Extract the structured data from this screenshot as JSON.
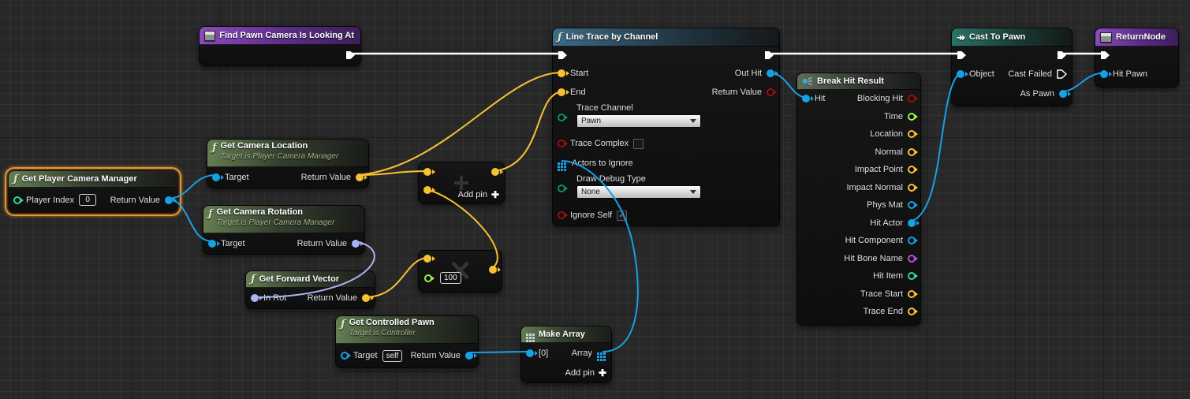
{
  "colors": {
    "background": "#282828",
    "exec_wire": "#ffffff",
    "vector": "#f7c231",
    "object": "#18a0e4",
    "rotator": "#a8b4f5",
    "float": "#9cf14b",
    "bool": "#9a0f0f",
    "enum": "#0e8a72",
    "int": "#2fd8a0",
    "name": "#bb4fd6",
    "selection": "#e8962e"
  },
  "nodes": {
    "find_pawn_camera": {
      "title": "Find Pawn Camera Is Looking At"
    },
    "get_player_camera_manager": {
      "title": "Get Player Camera Manager",
      "player_index_label": "Player Index",
      "player_index_value": "0",
      "return_value_label": "Return Value"
    },
    "get_camera_location": {
      "title": "Get Camera Location",
      "subtitle": "Target is Player Camera Manager",
      "target_label": "Target",
      "return_value_label": "Return Value"
    },
    "get_camera_rotation": {
      "title": "Get Camera Rotation",
      "subtitle": "Target is Player Camera Manager",
      "target_label": "Target",
      "return_value_label": "Return Value"
    },
    "get_forward_vector": {
      "title": "Get Forward Vector",
      "in_rot_label": "In Rot",
      "return_value_label": "Return Value"
    },
    "vector_add": {
      "watermark": "+",
      "add_pin_label": "Add pin",
      "add_pin_plus": "✚"
    },
    "vector_multiply": {
      "watermark": "✕",
      "scalar_value": "100"
    },
    "get_controlled_pawn": {
      "title": "Get Controlled Pawn",
      "subtitle": "Target is Controller",
      "target_label": "Target",
      "target_value": "self",
      "return_value_label": "Return Value"
    },
    "make_array": {
      "title": "Make Array",
      "element_label": "[0]",
      "array_label": "Array",
      "add_pin_label": "Add pin",
      "add_pin_plus": "✚"
    },
    "line_trace": {
      "title": "Line Trace by Channel",
      "start_label": "Start",
      "end_label": "End",
      "trace_channel_label": "Trace Channel",
      "trace_channel_value": "Pawn",
      "trace_complex_label": "Trace Complex",
      "actors_to_ignore_label": "Actors to Ignore",
      "draw_debug_type_label": "Draw Debug Type",
      "draw_debug_type_value": "None",
      "ignore_self_label": "Ignore Self",
      "out_hit_label": "Out Hit",
      "return_value_label": "Return Value"
    },
    "break_hit_result": {
      "title": "Break Hit Result",
      "hit_label": "Hit",
      "outputs": [
        "Blocking Hit",
        "Time",
        "Location",
        "Normal",
        "Impact Point",
        "Impact Normal",
        "Phys Mat",
        "Hit Actor",
        "Hit Component",
        "Hit Bone Name",
        "Hit Item",
        "Trace Start",
        "Trace End"
      ]
    },
    "cast_to_pawn": {
      "title": "Cast To Pawn",
      "object_label": "Object",
      "cast_failed_label": "Cast Failed",
      "as_pawn_label": "As Pawn"
    },
    "return_node": {
      "title": "ReturnNode",
      "hit_pawn_label": "Hit Pawn"
    }
  },
  "connections": [
    "Find Pawn Camera Is Looking At.exec -> Line Trace by Channel.exec",
    "Line Trace by Channel.exec -> Cast To Pawn.exec",
    "Cast To Pawn.exec -> ReturnNode.exec",
    "Get Player Camera Manager.Return Value -> Get Camera Location.Target",
    "Get Player Camera Manager.Return Value -> Get Camera Rotation.Target",
    "Get Camera Location.Return Value -> Add.A",
    "Get Camera Location.Return Value -> Line Trace by Channel.Start",
    "Get Camera Rotation.Return Value -> Get Forward Vector.In Rot",
    "Get Forward Vector.Return Value -> Multiply.A",
    "Multiply.Result -> Add.B",
    "Add.Result -> Line Trace by Channel.End",
    "Get Controlled Pawn.Return Value -> Make Array.[0]",
    "Make Array.Array -> Line Trace by Channel.Actors to Ignore",
    "Line Trace by Channel.Out Hit -> Break Hit Result.Hit",
    "Break Hit Result.Hit Actor -> Cast To Pawn.Object",
    "Cast To Pawn.As Pawn -> ReturnNode.Hit Pawn"
  ]
}
